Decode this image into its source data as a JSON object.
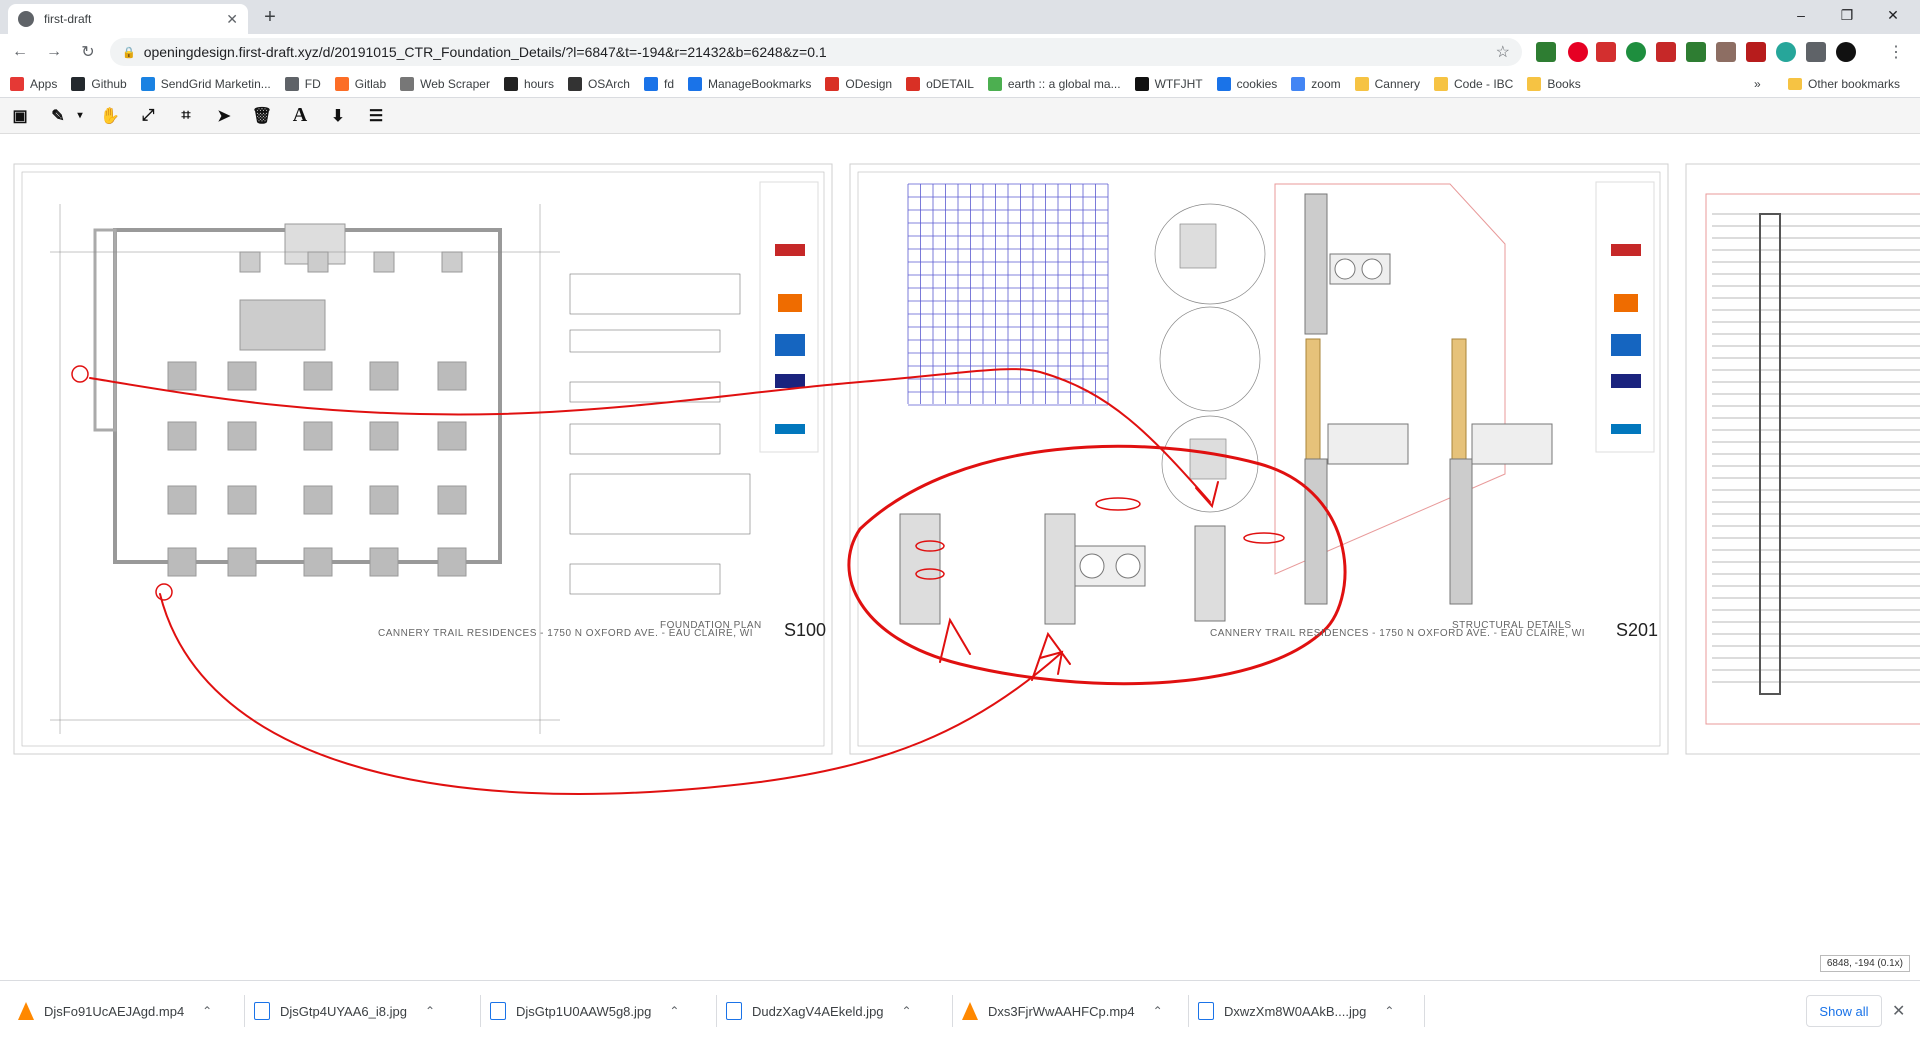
{
  "browser": {
    "tab_title": "first-draft",
    "url": "openingdesign.first-draft.xyz/d/20191015_CTR_Foundation_Details/?l=6847&t=-194&r=21432&b=6248&z=0.1",
    "new_tab_glyph": "+",
    "min_glyph": "–",
    "max_glyph": "❐",
    "close_glyph": "✕"
  },
  "bookmarks": [
    {
      "label": "Apps",
      "icon": "apps-grid-icon",
      "color": "#e53935"
    },
    {
      "label": "Github",
      "icon": "github-icon",
      "color": "#24292e"
    },
    {
      "label": "SendGrid Marketin...",
      "icon": "sendgrid-icon",
      "color": "#1a82e2"
    },
    {
      "label": "FD",
      "icon": "globe-icon",
      "color": "#5f6368"
    },
    {
      "label": "Gitlab",
      "icon": "gitlab-icon",
      "color": "#fc6d26"
    },
    {
      "label": "Web Scraper",
      "icon": "web-scraper-icon",
      "color": "#777777"
    },
    {
      "label": "hours",
      "icon": "hours-icon",
      "color": "#222222"
    },
    {
      "label": "OSArch",
      "icon": "osarch-icon",
      "color": "#333333"
    },
    {
      "label": "fd",
      "icon": "history-icon",
      "color": "#1a73e8"
    },
    {
      "label": "ManageBookmarks",
      "icon": "star-icon",
      "color": "#1a73e8"
    },
    {
      "label": "ODesign",
      "icon": "gmail-icon",
      "color": "#d93025"
    },
    {
      "label": "oDETAIL",
      "icon": "gmail-icon",
      "color": "#d93025"
    },
    {
      "label": "earth :: a global ma...",
      "icon": "earth-icon",
      "color": "#4caf50"
    },
    {
      "label": "WTFJHT",
      "icon": "wtfjht-icon",
      "color": "#111111"
    },
    {
      "label": "cookies",
      "icon": "gear-icon",
      "color": "#1a73e8"
    },
    {
      "label": "zoom",
      "icon": "doc-icon",
      "color": "#4285f4"
    },
    {
      "label": "Cannery",
      "icon": "folder-icon",
      "color": "#f6c343"
    },
    {
      "label": "Code - IBC",
      "icon": "folder-icon",
      "color": "#f6c343"
    },
    {
      "label": "Books",
      "icon": "folder-icon",
      "color": "#f6c343"
    }
  ],
  "bookmarks_more": "»",
  "other_bookmarks": "Other bookmarks",
  "sheets": {
    "left_title": "CANNERY TRAIL RESIDENCES - 1750 N OXFORD AVE. - EAU CLAIRE, WI",
    "left_label": "FOUNDATION PLAN",
    "left_num": "S100",
    "mid_title": "CANNERY TRAIL RESIDENCES - 1750 N OXFORD AVE. - EAU CLAIRE, WI",
    "mid_label": "STRUCTURAL DETAILS",
    "mid_num": "S201"
  },
  "coordinate_readout": "6848, -194 (0.1x)",
  "downloads": [
    {
      "name": "DjsFo91UcAEJAgd.mp4",
      "icon": "vlc-icon"
    },
    {
      "name": "DjsGtp4UYAA6_i8.jpg",
      "icon": "image-file-icon"
    },
    {
      "name": "DjsGtp1U0AAW5g8.jpg",
      "icon": "image-file-icon"
    },
    {
      "name": "DudzXagV4AEkeld.jpg",
      "icon": "image-file-icon"
    },
    {
      "name": "Dxs3FjrWwAAHFCp.mp4",
      "icon": "vlc-icon"
    },
    {
      "name": "DxwzXm8W0AAkB....jpg",
      "icon": "image-file-icon"
    }
  ],
  "show_all": "Show all",
  "colors": {
    "annotation_red": "#e01010",
    "grid_blue": "#5a5ad0",
    "plan_gray": "#888888"
  }
}
